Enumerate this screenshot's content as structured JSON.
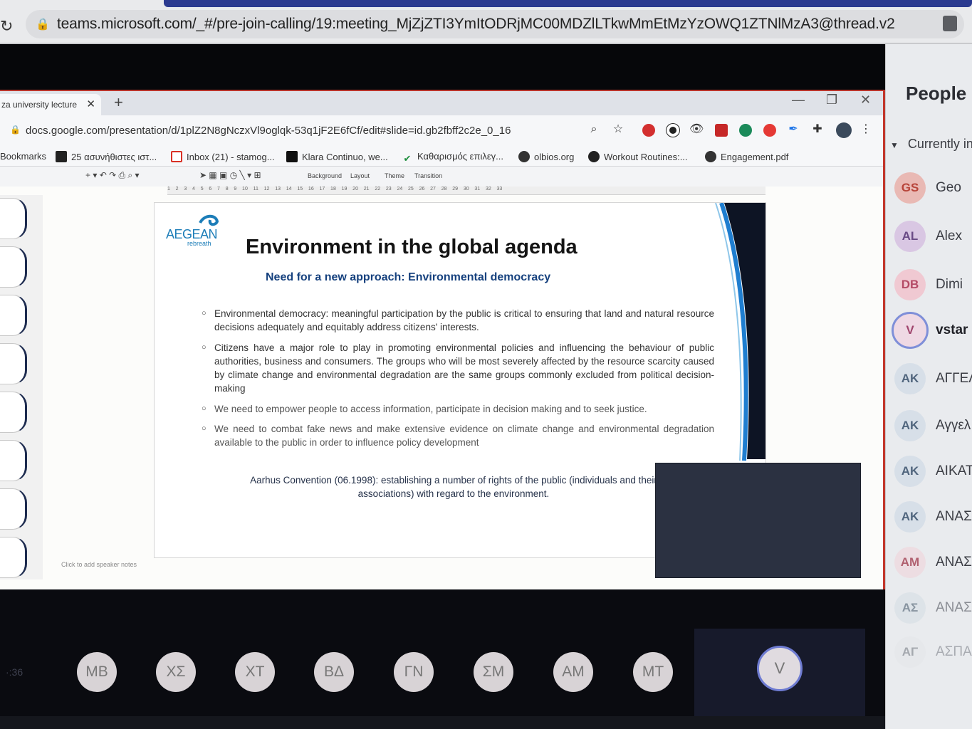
{
  "outer_browser": {
    "url": "teams.microsoft.com/_#/pre-join-calling/19:meeting_MjZjZTI3YmItODRjMC00MDZlLTkwMmEtMzYzOWQ1ZTNlMzA3@thread.v2"
  },
  "inner_browser": {
    "tab_label": "za university lecture",
    "url": "docs.google.com/presentation/d/1plZ2N8gNczxVl9oglqk-53q1jF2E6fCf/edit#slide=id.gb2fbff2c2e_0_16",
    "bookmarks": [
      {
        "label": "Bookmarks",
        "icon": "none",
        "color": ""
      },
      {
        "label": "25 ασυνήθιστες ιστ...",
        "icon": "t-icon",
        "color": "#222222"
      },
      {
        "label": "Inbox (21) - stamog...",
        "icon": "gmail-icon",
        "color": "#d93025"
      },
      {
        "label": "Klara Continuo, we...",
        "icon": "square-icon",
        "color": "#111111"
      },
      {
        "label": "Καθαρισμός επιλεγ...",
        "icon": "check-icon",
        "color": "#1e8e3e"
      },
      {
        "label": "olbios.org",
        "icon": "globe-icon",
        "color": "#333333"
      },
      {
        "label": "Workout Routines:...",
        "icon": "circle-icon",
        "color": "#222222"
      },
      {
        "label": "Engagement.pdf",
        "icon": "globe-icon",
        "color": "#333333"
      }
    ]
  },
  "slides_toolbar": {
    "background": "Background",
    "layout": "Layout",
    "theme": "Theme",
    "transition": "Transition",
    "ruler": "1    2    3    4    5    6    7    8    9    10    11    12    13    14    15    16    17    18    19    20    21    22    23    24    25    26    27    28    29    30    31    32    33",
    "notes_hint": "Click to add speaker notes"
  },
  "slide": {
    "logo_word": "AEGEAN",
    "logo_sub": "rebreath",
    "title": "Environment in the global agenda",
    "subtitle": "Need for a new approach: Environmental democracy",
    "bullets": [
      "Environmental democracy: meaningful participation by the public is critical to ensuring that land and natural resource decisions adequately and equitably address citizens' interests.",
      "Citizens have a major role to play in promoting environmental policies and influencing the behaviour of public authorities, business and consumers. The groups who will be most severely affected by the resource scarcity caused by climate change and environmental degradation are the same groups commonly excluded from political decision-making",
      "We need to empower people to access information, participate in decision making and to seek justice.",
      "We need to combat fake news and make extensive evidence on climate change and environmental degradation available to the public in order to influence policy development"
    ],
    "aarhus": "Aarhus Convention (06.1998): establishing a number of rights of the public (individuals and their associations) with regard to the environment."
  },
  "people": {
    "title": "People",
    "section": "Currently in",
    "participants": [
      {
        "initials": "GS",
        "name": "Geo",
        "bg": "#e9b9b4",
        "fg": "#b8453a"
      },
      {
        "initials": "AL",
        "name": "Alex",
        "bg": "#d9c7e3",
        "fg": "#6a4b86"
      },
      {
        "initials": "DB",
        "name": "Dimi",
        "bg": "#f0c9d2",
        "fg": "#b44b66"
      },
      {
        "initials": "V",
        "name": "vstar",
        "bg": "#efd9e4",
        "fg": "#a0466e"
      },
      {
        "initials": "AK",
        "name": "ΑΓΓΕΛ",
        "bg": "#d7dfe8",
        "fg": "#50657d"
      },
      {
        "initials": "AK",
        "name": "Αγγελ",
        "bg": "#d7dfe8",
        "fg": "#50657d"
      },
      {
        "initials": "AK",
        "name": "ΑΙΚΑΤ",
        "bg": "#d7dfe8",
        "fg": "#50657d"
      },
      {
        "initials": "AK",
        "name": "ΑΝΑΣΤ",
        "bg": "#d7dfe8",
        "fg": "#50657d"
      },
      {
        "initials": "AM",
        "name": "ΑΝΑΣΤ",
        "bg": "#eddde2",
        "fg": "#b0606f"
      },
      {
        "initials": "ΑΣ",
        "name": "ΑΝΑΣΤ",
        "bg": "#dde3e8",
        "fg": "#8894a0"
      },
      {
        "initials": "ΑΓ",
        "name": "ΑΣΠΑΣ",
        "bg": "#e6e8eb",
        "fg": "#a4a8ae"
      }
    ]
  },
  "callbar": {
    "timer": "·:36",
    "avatars": [
      "MB",
      "ΧΣ",
      "XT",
      "ΒΔ",
      "ΓΝ",
      "ΣΜ",
      "AM",
      "MT"
    ],
    "self": "V"
  }
}
